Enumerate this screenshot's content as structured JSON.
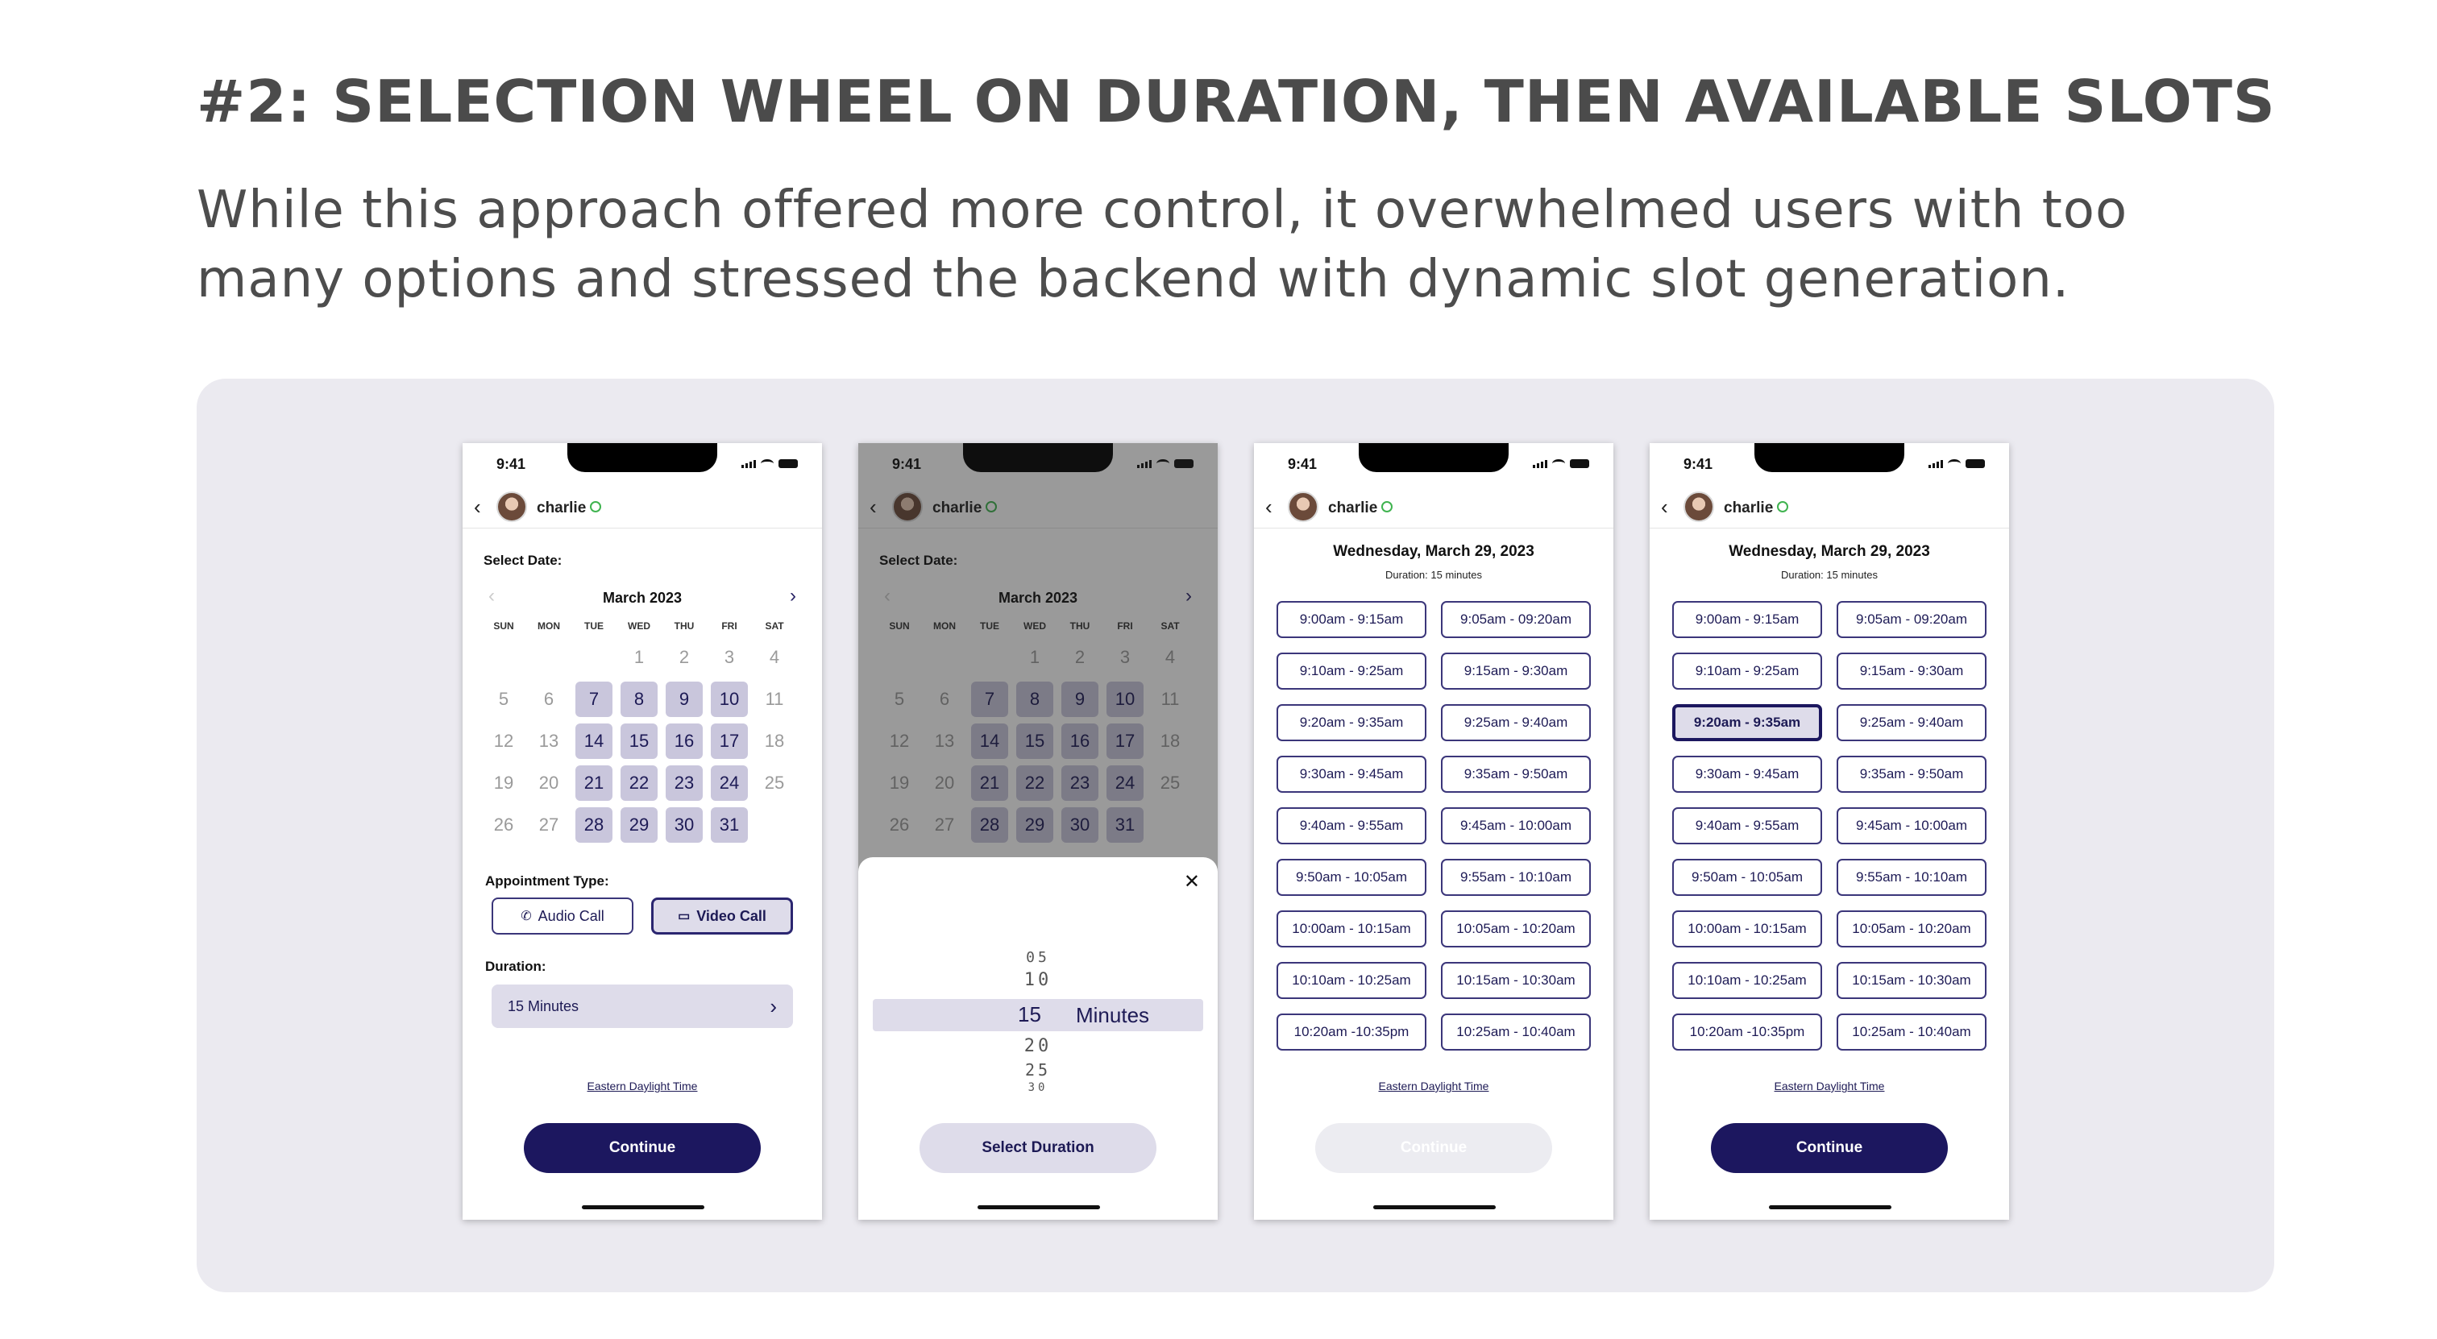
{
  "heading": "#2: SELECTION WHEEL ON DURATION, THEN AVAILABLE SLOTS",
  "description": "While this approach offered more control, it overwhelmed users with too many options and stressed the backend with dynamic slot generation.",
  "phone": {
    "time": "9:41",
    "back_icon": "‹",
    "username": "charlie"
  },
  "calendar": {
    "select_date_label": "Select Date:",
    "month": "March 2023",
    "prev_icon": "‹",
    "next_icon": "›",
    "weekdays": [
      "SUN",
      "MON",
      "TUE",
      "WED",
      "THU",
      "FRI",
      "SAT"
    ],
    "days": [
      {
        "d": "",
        "a": false
      },
      {
        "d": "",
        "a": false
      },
      {
        "d": "",
        "a": false
      },
      {
        "d": "1",
        "a": false
      },
      {
        "d": "2",
        "a": false
      },
      {
        "d": "3",
        "a": false
      },
      {
        "d": "4",
        "a": false
      },
      {
        "d": "5",
        "a": false
      },
      {
        "d": "6",
        "a": false
      },
      {
        "d": "7",
        "a": true
      },
      {
        "d": "8",
        "a": true
      },
      {
        "d": "9",
        "a": true
      },
      {
        "d": "10",
        "a": true
      },
      {
        "d": "11",
        "a": false
      },
      {
        "d": "12",
        "a": false
      },
      {
        "d": "13",
        "a": false
      },
      {
        "d": "14",
        "a": true
      },
      {
        "d": "15",
        "a": true
      },
      {
        "d": "16",
        "a": true
      },
      {
        "d": "17",
        "a": true
      },
      {
        "d": "18",
        "a": false
      },
      {
        "d": "19",
        "a": false
      },
      {
        "d": "20",
        "a": false
      },
      {
        "d": "21",
        "a": true
      },
      {
        "d": "22",
        "a": true
      },
      {
        "d": "23",
        "a": true
      },
      {
        "d": "24",
        "a": true
      },
      {
        "d": "25",
        "a": false
      },
      {
        "d": "26",
        "a": false
      },
      {
        "d": "27",
        "a": false
      },
      {
        "d": "28",
        "a": true
      },
      {
        "d": "29",
        "a": true
      },
      {
        "d": "30",
        "a": true
      },
      {
        "d": "31",
        "a": true
      },
      {
        "d": "",
        "a": false
      }
    ]
  },
  "appointment": {
    "label": "Appointment Type:",
    "audio": "Audio Call",
    "video": "Video Call",
    "audio_icon": "✆",
    "video_icon": "▭"
  },
  "duration": {
    "label": "Duration:",
    "value": "15 Minutes",
    "chevron": "›"
  },
  "timezone": "Eastern Daylight Time",
  "continue_label": "Continue",
  "picker": {
    "close_icon": "✕",
    "items": [
      "05",
      "10",
      "15",
      "20",
      "25",
      "30"
    ],
    "selected": "15",
    "unit": "Minutes",
    "button": "Select Duration"
  },
  "slots_screen": {
    "date": "Wednesday, March 29, 2023",
    "duration": "Duration: 15 minutes",
    "slots": [
      "9:00am - 9:15am",
      "9:05am - 09:20am",
      "9:10am - 9:25am",
      "9:15am - 9:30am",
      "9:20am - 9:35am",
      "9:25am - 9:40am",
      "9:30am - 9:45am",
      "9:35am - 9:50am",
      "9:40am - 9:55am",
      "9:45am - 10:00am",
      "9:50am - 10:05am",
      "9:55am - 10:10am",
      "10:00am - 10:15am",
      "10:05am - 10:20am",
      "10:10am - 10:25am",
      "10:15am - 10:30am",
      "10:20am -10:35pm",
      "10:25am - 10:40am"
    ],
    "selected_index_screen4": 4
  },
  "colors": {
    "accent": "#1c175f",
    "available_day": "#c9c6dc",
    "panel_bg": "#ebeaf0",
    "online": "#3fb34f"
  }
}
